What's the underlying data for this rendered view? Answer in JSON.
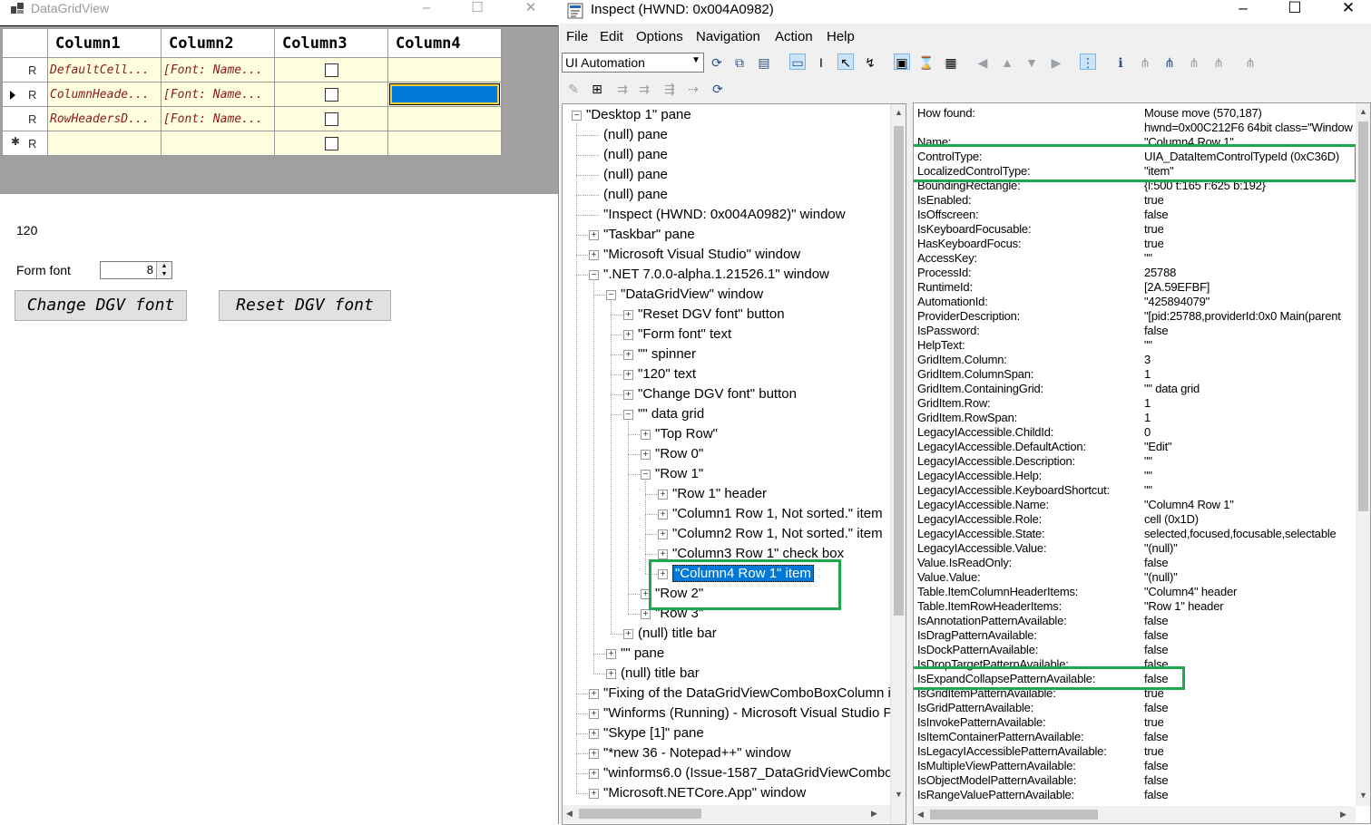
{
  "dgv_window": {
    "title": "DataGridView",
    "caption_buttons": [
      "–",
      "☐",
      "✕"
    ],
    "grid": {
      "headers": [
        "Column1",
        "Column2",
        "Column3",
        "Column4"
      ],
      "rows": [
        {
          "header": "R",
          "c1": "DefaultCell...",
          "c2": "[Font: Name...",
          "current": false,
          "new": false
        },
        {
          "header": "R",
          "c1": "ColumnHeade...",
          "c2": "[Font: Name...",
          "current": true,
          "new": false
        },
        {
          "header": "R",
          "c1": "RowHeadersD...",
          "c2": "[Font: Name...",
          "current": false,
          "new": false
        },
        {
          "header": "R",
          "c1": "",
          "c2": "",
          "current": false,
          "new": true
        }
      ]
    },
    "value_label": "120",
    "form_font_label": "Form font",
    "form_font_value": "8",
    "change_button": "Change DGV font",
    "reset_button": "Reset DGV font"
  },
  "inspect_window": {
    "title": "Inspect  (HWND: 0x004A0982)",
    "caption_buttons": [
      "–",
      "☐",
      "✕"
    ],
    "menu": [
      "File",
      "Edit",
      "Options",
      "Navigation",
      "Action",
      "Help"
    ],
    "mode_combo": "UI Automation",
    "tree": [
      {
        "text": "\"Desktop 1\" pane",
        "level": 0,
        "exp": "-"
      },
      {
        "text": "(null) pane",
        "level": 1,
        "exp": ""
      },
      {
        "text": "(null) pane",
        "level": 1,
        "exp": ""
      },
      {
        "text": "(null) pane",
        "level": 1,
        "exp": ""
      },
      {
        "text": "(null) pane",
        "level": 1,
        "exp": ""
      },
      {
        "text": "\"Inspect  (HWND: 0x004A0982)\" window",
        "level": 1,
        "exp": ""
      },
      {
        "text": "\"Taskbar\" pane",
        "level": 1,
        "exp": "+"
      },
      {
        "text": "\"Microsoft Visual Studio\" window",
        "level": 1,
        "exp": "+"
      },
      {
        "text": "\".NET 7.0.0-alpha.1.21526.1\" window",
        "level": 1,
        "exp": "-"
      },
      {
        "text": "\"DataGridView\" window",
        "level": 2,
        "exp": "-"
      },
      {
        "text": "\"Reset DGV font\" button",
        "level": 3,
        "exp": "+"
      },
      {
        "text": "\"Form font\" text",
        "level": 3,
        "exp": "+"
      },
      {
        "text": "\"\" spinner",
        "level": 3,
        "exp": "+"
      },
      {
        "text": "\"120\" text",
        "level": 3,
        "exp": "+"
      },
      {
        "text": "\"Change DGV font\" button",
        "level": 3,
        "exp": "+"
      },
      {
        "text": "\"\" data grid",
        "level": 3,
        "exp": "-"
      },
      {
        "text": "\"Top Row\"",
        "level": 4,
        "exp": "+"
      },
      {
        "text": "\"Row 0\"",
        "level": 4,
        "exp": "+"
      },
      {
        "text": "\"Row 1\"",
        "level": 4,
        "exp": "-"
      },
      {
        "text": "\"Row 1\" header",
        "level": 5,
        "exp": "+"
      },
      {
        "text": "\"Column1 Row 1, Not sorted.\" item",
        "level": 5,
        "exp": "+"
      },
      {
        "text": "\"Column2 Row 1, Not sorted.\" item",
        "level": 5,
        "exp": "+"
      },
      {
        "text": "\"Column3 Row 1\" check box",
        "level": 5,
        "exp": "+"
      },
      {
        "text": "\"Column4 Row 1\" item",
        "level": 5,
        "exp": "+",
        "selected": true
      },
      {
        "text": "\"Row 2\"",
        "level": 4,
        "exp": "+"
      },
      {
        "text": "\"Row 3\"",
        "level": 4,
        "exp": "+"
      },
      {
        "text": "(null) title bar",
        "level": 3,
        "exp": "+"
      },
      {
        "text": "\"\" pane",
        "level": 2,
        "exp": "+"
      },
      {
        "text": "(null) title bar",
        "level": 2,
        "exp": "+"
      },
      {
        "text": "\"Fixing of the DataGridViewComboBoxColumn i",
        "level": 1,
        "exp": "+"
      },
      {
        "text": "\"Winforms (Running) - Microsoft Visual Studio P",
        "level": 1,
        "exp": "+"
      },
      {
        "text": "\"Skype [1]\" pane",
        "level": 1,
        "exp": "+"
      },
      {
        "text": "\"*new 36 - Notepad++\" window",
        "level": 1,
        "exp": "+"
      },
      {
        "text": "\"winforms6.0 (Issue-1587_DataGridViewCombol",
        "level": 1,
        "exp": "+"
      },
      {
        "text": "\"Microsoft.NETCore.App\" window",
        "level": 1,
        "exp": "+"
      }
    ],
    "properties": [
      [
        "How found:",
        "Mouse move (570,187)"
      ],
      [
        "",
        "hwnd=0x00C212F6 64bit class=\"Window"
      ],
      [
        "Name:",
        "\"Column4 Row 1\""
      ],
      [
        "ControlType:",
        "UIA_DataItemControlTypeId (0xC36D)"
      ],
      [
        "LocalizedControlType:",
        "\"item\""
      ],
      [
        "BoundingRectangle:",
        "{l:500 t:165 r:625 b:192}"
      ],
      [
        "IsEnabled:",
        "true"
      ],
      [
        "IsOffscreen:",
        "false"
      ],
      [
        "IsKeyboardFocusable:",
        "true"
      ],
      [
        "HasKeyboardFocus:",
        "true"
      ],
      [
        "AccessKey:",
        "\"\""
      ],
      [
        "ProcessId:",
        "25788"
      ],
      [
        "RuntimeId:",
        "[2A.59EFBF]"
      ],
      [
        "AutomationId:",
        "\"425894079\""
      ],
      [
        "ProviderDescription:",
        "\"[pid:25788,providerId:0x0 Main(parent"
      ],
      [
        "IsPassword:",
        "false"
      ],
      [
        "HelpText:",
        "\"\""
      ],
      [
        "GridItem.Column:",
        "3"
      ],
      [
        "GridItem.ColumnSpan:",
        "1"
      ],
      [
        "GridItem.ContainingGrid:",
        "\"\" data grid"
      ],
      [
        "GridItem.Row:",
        "1"
      ],
      [
        "GridItem.RowSpan:",
        "1"
      ],
      [
        "LegacyIAccessible.ChildId:",
        "0"
      ],
      [
        "LegacyIAccessible.DefaultAction:",
        "\"Edit\""
      ],
      [
        "LegacyIAccessible.Description:",
        "\"\""
      ],
      [
        "LegacyIAccessible.Help:",
        "\"\""
      ],
      [
        "LegacyIAccessible.KeyboardShortcut:",
        "\"\""
      ],
      [
        "LegacyIAccessible.Name:",
        "\"Column4 Row 1\""
      ],
      [
        "LegacyIAccessible.Role:",
        "cell (0x1D)"
      ],
      [
        "LegacyIAccessible.State:",
        "selected,focused,focusable,selectable"
      ],
      [
        "LegacyIAccessible.Value:",
        "\"(null)\""
      ],
      [
        "Value.IsReadOnly:",
        "false"
      ],
      [
        "Value.Value:",
        "\"(null)\""
      ],
      [
        "Table.ItemColumnHeaderItems:",
        "\"Column4\" header"
      ],
      [
        "Table.ItemRowHeaderItems:",
        "\"Row 1\" header"
      ],
      [
        "IsAnnotationPatternAvailable:",
        "false"
      ],
      [
        "IsDragPatternAvailable:",
        "false"
      ],
      [
        "IsDockPatternAvailable:",
        "false"
      ],
      [
        "IsDropTargetPatternAvailable:",
        "false"
      ],
      [
        "IsExpandCollapsePatternAvailable:",
        "false"
      ],
      [
        "IsGridItemPatternAvailable:",
        "true"
      ],
      [
        "IsGridPatternAvailable:",
        "false"
      ],
      [
        "IsInvokePatternAvailable:",
        "true"
      ],
      [
        "IsItemContainerPatternAvailable:",
        "false"
      ],
      [
        "IsLegacyIAccessiblePatternAvailable:",
        "true"
      ],
      [
        "IsMultipleViewPatternAvailable:",
        "false"
      ],
      [
        "IsObjectModelPatternAvailable:",
        "false"
      ],
      [
        "IsRangeValuePatternAvailable:",
        "false"
      ]
    ],
    "highlight_color": "#1ea84a",
    "selection_color": "#0078d7"
  }
}
